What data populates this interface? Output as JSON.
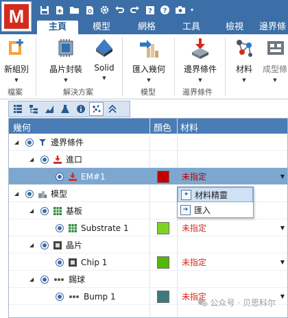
{
  "app": {
    "logo_letter": "M",
    "quick_access": [
      "save-icon",
      "new-icon",
      "open-icon",
      "search-file-icon",
      "settings-icon",
      "undo-icon",
      "redo-icon",
      "help-box-icon",
      "help-icon",
      "camera-icon",
      "dropdown-icon"
    ]
  },
  "tabs": [
    {
      "label": "主頁",
      "active": true
    },
    {
      "label": "模型",
      "active": false
    },
    {
      "label": "網格",
      "active": false
    },
    {
      "label": "工具",
      "active": false
    },
    {
      "label": "檢視",
      "active": false
    },
    {
      "label": "邊界條",
      "active": false
    }
  ],
  "ribbon": {
    "buttons": {
      "new_group": "新組別",
      "chip_package": "晶片封裝",
      "solid": "Solid",
      "import_geometry": "匯入幾何",
      "boundary": "邊界條件",
      "material": "材料",
      "mold": "成型條"
    },
    "groups": {
      "file": "檔案",
      "solutions": "解決方案",
      "model": "模型",
      "boundary": "邊界條件"
    }
  },
  "grid": {
    "columns": {
      "geometry": "幾何",
      "color": "顏色",
      "material": "材料"
    },
    "rows": [
      {
        "name": "邊界條件",
        "level": 0,
        "icon": "boundary-icon",
        "color": "",
        "material": ""
      },
      {
        "name": "進口",
        "level": 1,
        "icon": "inlet-icon",
        "color": "",
        "material": ""
      },
      {
        "name": "EM#1",
        "level": 2,
        "icon": "inlet-icon",
        "color": "#c00000",
        "material": "未指定",
        "selected": true
      },
      {
        "name": "模型",
        "level": 0,
        "icon": "model-icon",
        "color": "",
        "material": ""
      },
      {
        "name": "基板",
        "level": 1,
        "icon": "substrate-icon",
        "color": "",
        "material": ""
      },
      {
        "name": "Substrate 1",
        "level": 2,
        "icon": "substrate-icon",
        "color": "#7ed321",
        "material": "未指定"
      },
      {
        "name": "晶片",
        "level": 1,
        "icon": "chip-icon",
        "color": "",
        "material": ""
      },
      {
        "name": "Chip 1",
        "level": 2,
        "icon": "chip-icon",
        "color": "#52b80a",
        "material": "未指定"
      },
      {
        "name": "錫球",
        "level": 1,
        "icon": "bump-icon",
        "color": "",
        "material": ""
      },
      {
        "name": "Bump 1",
        "level": 2,
        "icon": "bump-icon",
        "color": "#3f7a7a",
        "material": "未指定"
      }
    ]
  },
  "popup": {
    "items": [
      "材料精靈",
      "匯入"
    ]
  },
  "watermark": "公众号 · 贝思科尔"
}
